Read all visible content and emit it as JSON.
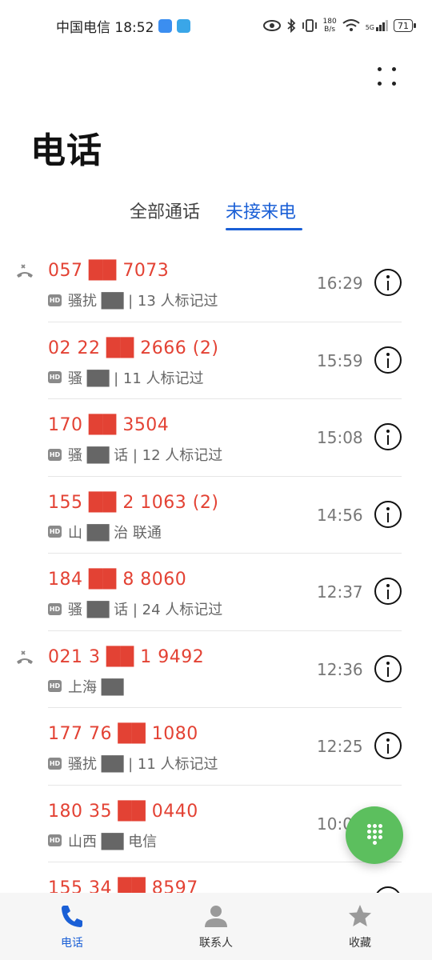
{
  "status_bar": {
    "carrier_time": "中国电信 18:52",
    "speed_value": "180",
    "speed_unit": "B/s",
    "signal": "5G",
    "battery": "71"
  },
  "page_title": "电话",
  "tabs": {
    "all": "全部通话",
    "missed": "未接来电"
  },
  "calls": [
    {
      "number": "057 ██ 7073",
      "subtitle": "骚扰 ██ | 13 人标记过",
      "time": "16:29",
      "missed_icon": true
    },
    {
      "number": "02‍ 22 ██ 2666 (2)",
      "subtitle": "骚 ██ | 11 人标记过",
      "time": "15:59",
      "missed_icon": false
    },
    {
      "number": "170 ██ 3504",
      "subtitle": "骚 ██ 话 | 12 人标记过",
      "time": "15:08",
      "missed_icon": false
    },
    {
      "number": "155 ██ 2 1063 (2)",
      "subtitle": "山 ██ 治 联通",
      "time": "14:56",
      "missed_icon": false
    },
    {
      "number": "184 ██ 8 8060",
      "subtitle": "骚 ██ 话 | 24 人标记过",
      "time": "12:37",
      "missed_icon": false
    },
    {
      "number": "021 3 ██ 1 9492",
      "subtitle": "上海 ██",
      "time": "12:36",
      "missed_icon": true
    },
    {
      "number": "177 76 ██ 1080",
      "subtitle": "骚扰 ██ | 11 人标记过",
      "time": "12:25",
      "missed_icon": false
    },
    {
      "number": "180 35 ██ 0440",
      "subtitle": "山西 ██ 电信",
      "time": "10:0",
      "missed_icon": false
    },
    {
      "number": "155 34 ██ 8597",
      "subtitle": "",
      "time": "",
      "missed_icon": false
    }
  ],
  "hd_label": "HD",
  "bottom_nav": {
    "phone": "电话",
    "contacts": "联系人",
    "favorites": "收藏"
  },
  "colors": {
    "accent": "#1a5fd6",
    "missed": "#e34234",
    "fab": "#5cbf5e"
  }
}
